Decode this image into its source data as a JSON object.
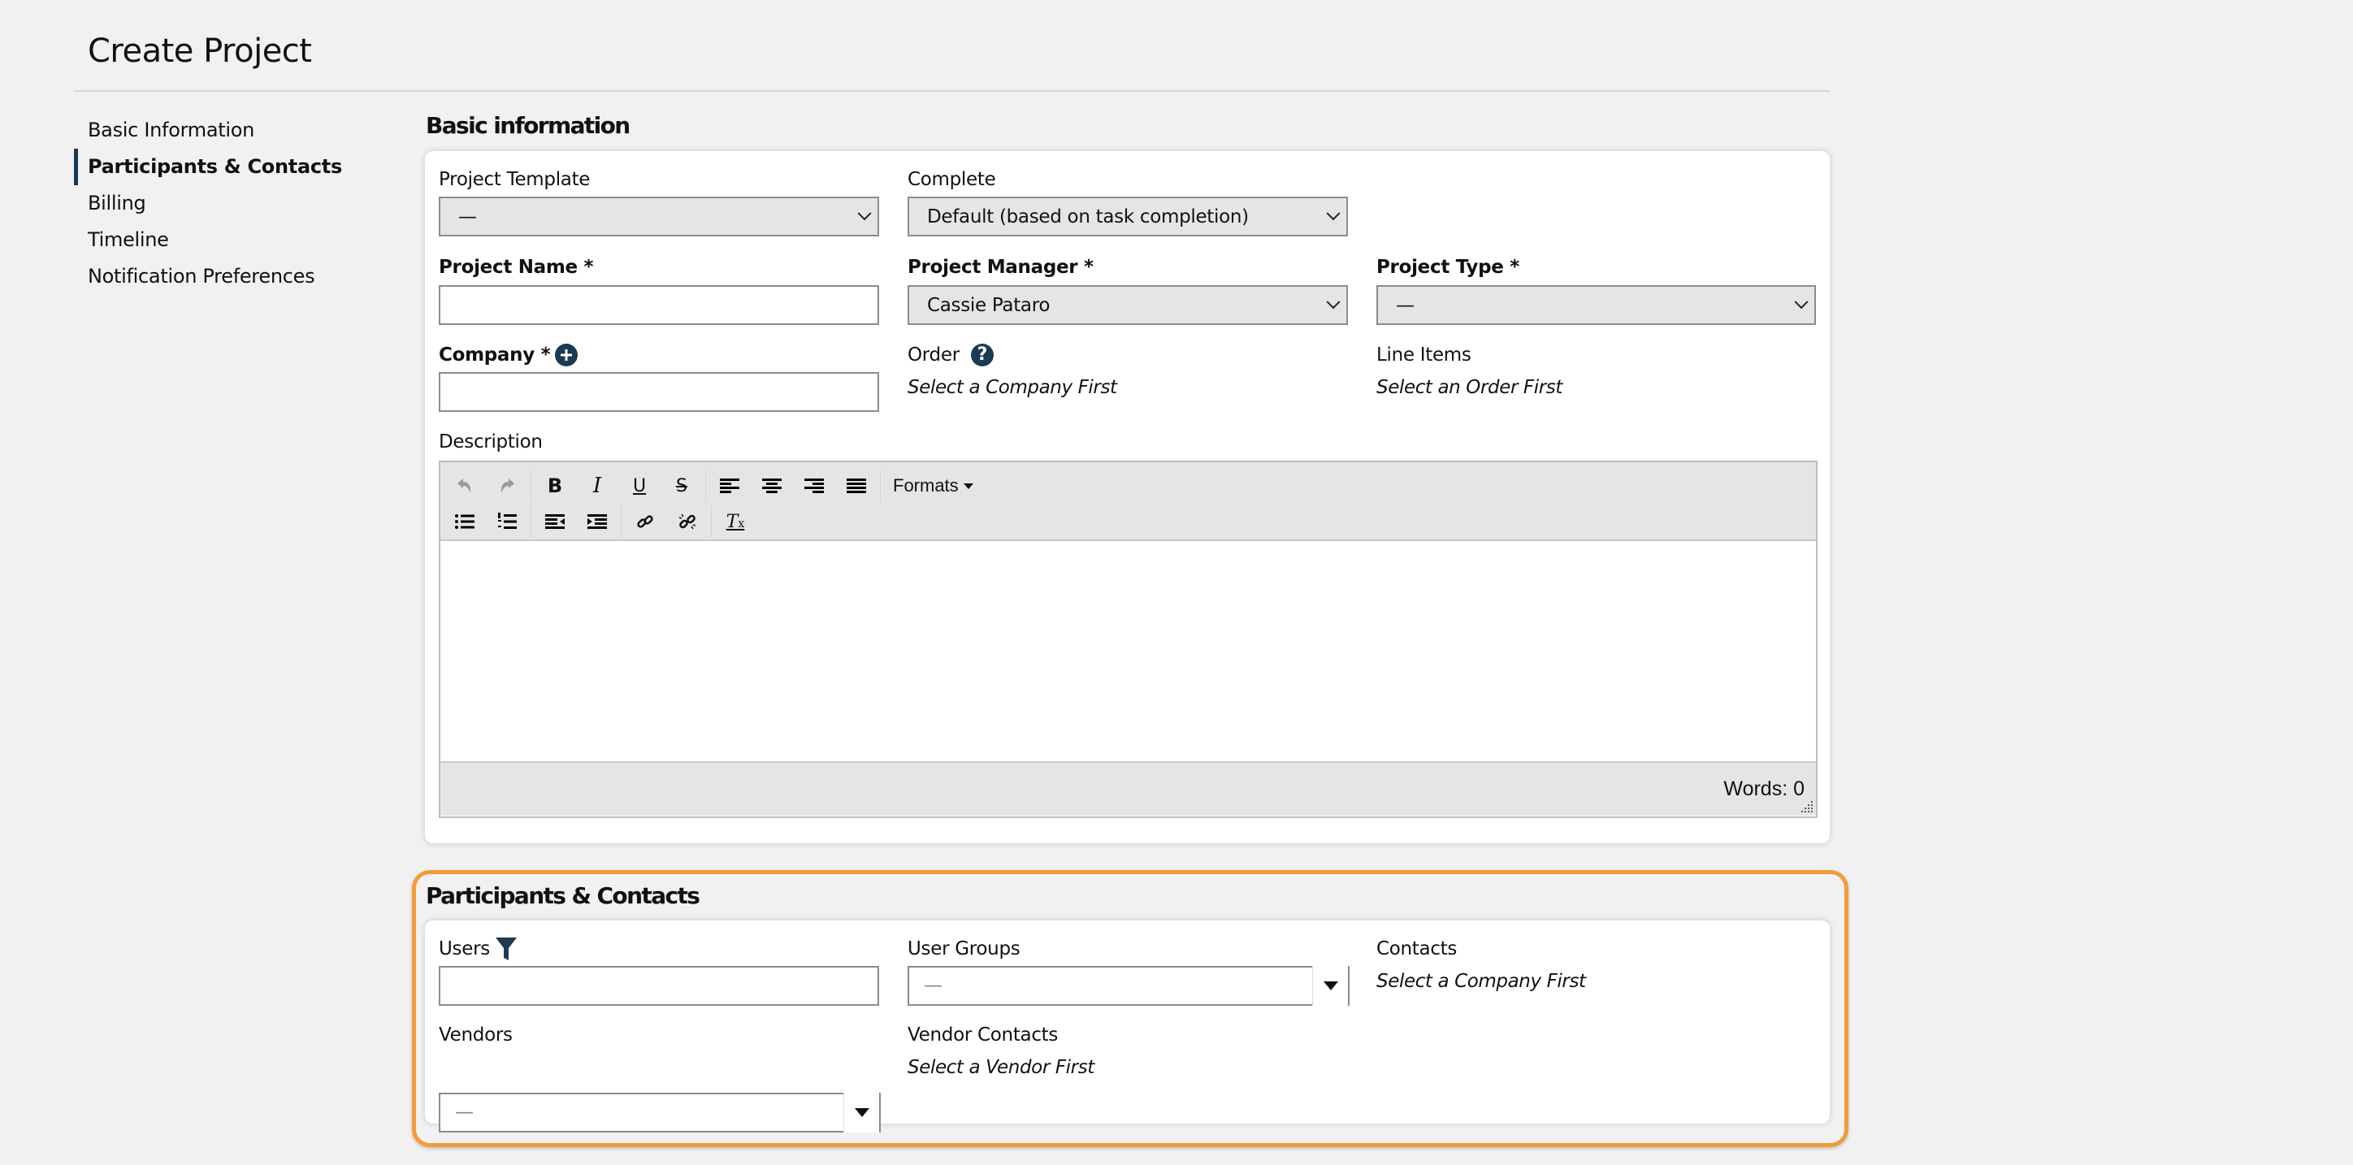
{
  "page": {
    "title": "Create Project"
  },
  "sidebar": {
    "items": [
      {
        "label": "Basic Information",
        "active": false
      },
      {
        "label": "Participants & Contacts",
        "active": true
      },
      {
        "label": "Billing",
        "active": false
      },
      {
        "label": "Timeline",
        "active": false
      },
      {
        "label": "Notification Preferences",
        "active": false
      }
    ]
  },
  "basic_info": {
    "section_title": "Basic information",
    "project_template": {
      "label": "Project Template",
      "value": "—"
    },
    "complete": {
      "label": "Complete",
      "value": "Default (based on task completion)"
    },
    "project_name": {
      "label": "Project Name *",
      "value": ""
    },
    "project_manager": {
      "label": "Project Manager *",
      "value": "Cassie Pataro"
    },
    "project_type": {
      "label": "Project Type *",
      "value": "—"
    },
    "company": {
      "label": "Company *",
      "value": "",
      "add_icon": "plus-circle-icon"
    },
    "order": {
      "label": "Order",
      "hint": "Select a Company First",
      "help_icon": "question-circle-icon"
    },
    "line_items": {
      "label": "Line Items",
      "hint": "Select an Order First"
    },
    "description": {
      "label": "Description",
      "toolbar": {
        "row1": [
          "undo",
          "redo",
          "bold",
          "italic",
          "underline",
          "strikethrough",
          "align-left",
          "align-center",
          "align-right",
          "align-justify"
        ],
        "formats_label": "Formats",
        "row2": [
          "bullet-list",
          "numbered-list",
          "outdent",
          "indent",
          "link",
          "unlink",
          "clear-formatting"
        ]
      },
      "content": "",
      "word_count": "Words: 0"
    }
  },
  "participants": {
    "section_title": "Participants & Contacts",
    "highlight_color": "#f29b38",
    "users": {
      "label": "Users",
      "filter_icon": "filter-icon",
      "value": ""
    },
    "user_groups": {
      "label": "User Groups",
      "value": "—"
    },
    "contacts": {
      "label": "Contacts",
      "hint": "Select a Company First"
    },
    "vendors": {
      "label": "Vendors",
      "value": "—"
    },
    "vendor_contacts": {
      "label": "Vendor Contacts",
      "hint": "Select a Vendor First"
    }
  },
  "colors": {
    "accent": "#1b3a53",
    "background": "#f1f1f1",
    "select_bg": "#e5e5e5"
  }
}
